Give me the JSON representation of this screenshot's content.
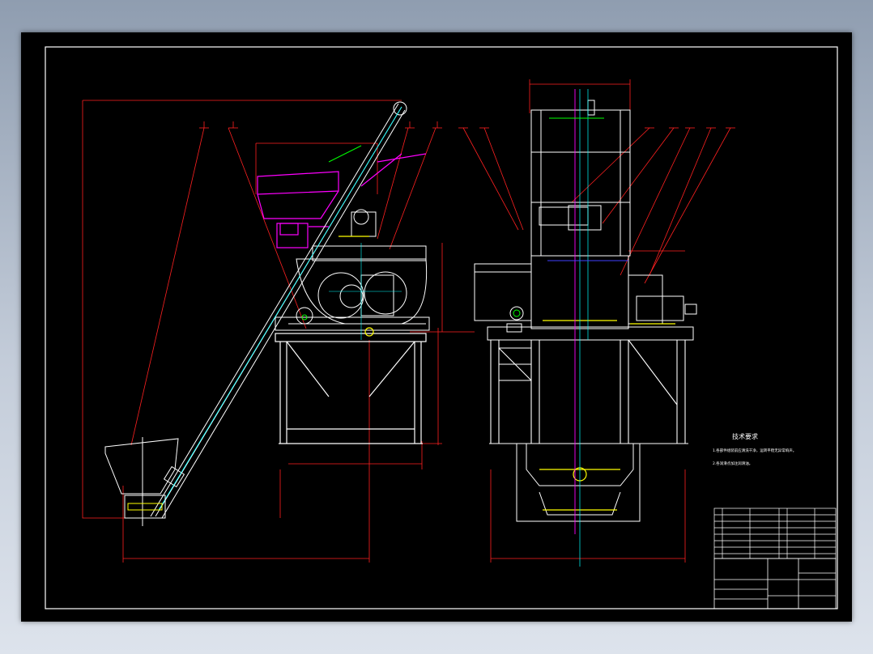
{
  "drawing": {
    "notes_title": "技术要求",
    "notes_lines": [
      "1.各部件组装前应清洗干净，运转平稳无异常响声。",
      "2.各润滑点加注润滑油。"
    ]
  },
  "colors": {
    "background": "#000000",
    "frame": "#ffffff",
    "dimension": "#ff2020",
    "centerline": "#00ffff",
    "hopper": "#ff00ff",
    "highlight": "#ffff00",
    "green": "#00ff00",
    "blue": "#4040ff"
  }
}
